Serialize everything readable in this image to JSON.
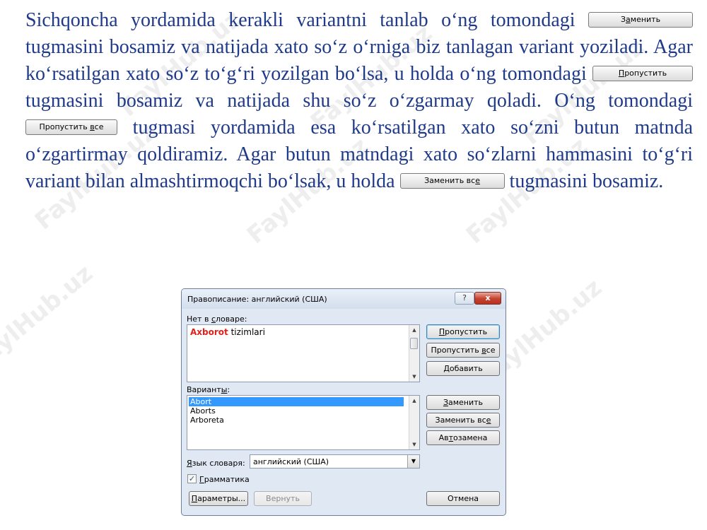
{
  "text": {
    "l1": "Sichqoncha yordamida kerakli variantni tanlab o‘ng tomondagi",
    "l2": "tugmasini bosamiz va natijada xato so‘z o‘rniga biz tanlagan variant yoziladi. Agar ko‘rsatilgan xato so‘z to‘g‘ri yozilgan bo‘lsa, u holda o‘ng tomondagi",
    "l3": "tugmasini bosamiz va natijada shu so‘z o‘zgarmay qoladi. O‘ng tomondagi",
    "l4": "tugmasi yordamida esa ko‘rsatilgan xato so‘zni butun matnda o‘zgartirmay qoldiramiz. Agar butun matndagi xato so‘zlarni hammasini to‘g‘ri variant bilan almashtirmoqchi bo‘lsak, u holda",
    "l5": "tugmasini bosamiz."
  },
  "inline_buttons": {
    "zamenit": {
      "pre": "З",
      "mn": "а",
      "post": "менить"
    },
    "propustit": {
      "pre": "",
      "mn": "П",
      "post": "ропустить"
    },
    "propustit_vse": {
      "pre": "Пропустить ",
      "mn": "в",
      "post": "се"
    },
    "zamenit_vse": {
      "pre": "Заменить вс",
      "mn": "е",
      "post": ""
    }
  },
  "dialog": {
    "title": "Правописание: английский (США)",
    "help_label": "?",
    "close_label": "x",
    "not_in_dict": {
      "pre": "Нет в ",
      "mn": "с",
      "post": "ловаре:"
    },
    "bad_word": "Axborot",
    "rest_text": " tizimlari",
    "variants": {
      "pre": "Вариант",
      "mn": "ы",
      "post": ":"
    },
    "suggestions": [
      "Abort",
      "Aborts",
      "Arboreta"
    ],
    "lang_label": {
      "pre": "",
      "mn": "Я",
      "post": "зык словаря:"
    },
    "lang_value": "английский (США)",
    "grammar": {
      "pre": "",
      "mn": "Г",
      "post": "рамматика"
    },
    "buttons": {
      "skip": {
        "pre": "",
        "mn": "П",
        "post": "ропустить"
      },
      "skip_all": {
        "pre": "Пропустить ",
        "mn": "в",
        "post": "се"
      },
      "add": {
        "pre": "",
        "mn": "Д",
        "post": "обавить"
      },
      "replace": {
        "pre": "",
        "mn": "З",
        "post": "аменить"
      },
      "replace_all": {
        "pre": "Заменить вс",
        "mn": "е",
        "post": ""
      },
      "autocorrect": {
        "pre": "Ав",
        "mn": "т",
        "post": "озамена"
      },
      "options": {
        "pre": "",
        "mn": "П",
        "post": "араметры..."
      },
      "undo": "Вернуть",
      "cancel": "Отмена"
    }
  },
  "watermark": "FaylHub.uz"
}
